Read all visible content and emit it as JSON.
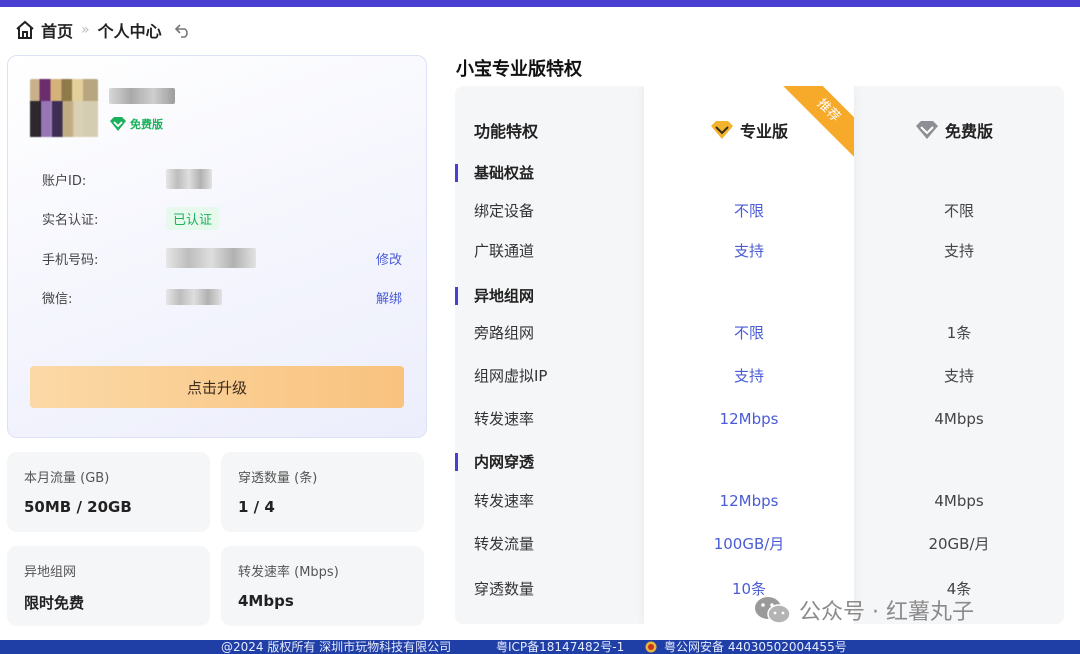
{
  "breadcrumb": {
    "home": "首页",
    "sep": "»",
    "current": "个人中心"
  },
  "profile": {
    "tier": "免费版",
    "rows": [
      {
        "label": "账户ID:"
      },
      {
        "label": "实名认证:",
        "status": "已认证"
      },
      {
        "label": "手机号码:",
        "action": "修改"
      },
      {
        "label": "微信:",
        "action": "解绑"
      }
    ],
    "upgrade_label": "点击升级"
  },
  "stats": [
    {
      "label": "本月流量 (GB)",
      "value": "50MB / 20GB"
    },
    {
      "label": "穿透数量 (条)",
      "value": "1 / 4"
    },
    {
      "label": "异地组网",
      "value": "限时免费"
    },
    {
      "label": "转发速率 (Mbps)",
      "value": "4Mbps"
    }
  ],
  "compare": {
    "title": "小宝专业版特权",
    "col_feature": "功能特权",
    "col_pro": "专业版",
    "col_free": "免费版",
    "ribbon": "推荐",
    "sections": [
      {
        "title": "基础权益",
        "rows": [
          {
            "feature": "绑定设备",
            "pro": "不限",
            "free": "不限"
          },
          {
            "feature": "广联通道",
            "pro": "支持",
            "free": "支持"
          }
        ]
      },
      {
        "title": "异地组网",
        "rows": [
          {
            "feature": "旁路组网",
            "pro": "不限",
            "free": "1条"
          },
          {
            "feature": "组网虚拟IP",
            "pro": "支持",
            "free": "支持"
          },
          {
            "feature": "转发速率",
            "pro": "12Mbps",
            "free": "4Mbps"
          }
        ]
      },
      {
        "title": "内网穿透",
        "rows": [
          {
            "feature": "转发速率",
            "pro": "12Mbps",
            "free": "4Mbps"
          },
          {
            "feature": "转发流量",
            "pro": "100GB/月",
            "free": "20GB/月"
          },
          {
            "feature": "穿透数量",
            "pro": "10条",
            "free": "4条"
          }
        ]
      }
    ]
  },
  "watermark": "公众号 · 红薯丸子",
  "footer": {
    "copyright": "@2024 版权所有 深圳市玩物科技有限公司",
    "icp": "粤ICP备18147482号-1",
    "police": "粤公网安备 44030502004455号"
  },
  "colors": {
    "accent": "#4a3fd3",
    "link": "#4a5bd6",
    "green": "#1bb15c",
    "ribbon": "#f7a929",
    "footer": "#1f3fa6"
  }
}
